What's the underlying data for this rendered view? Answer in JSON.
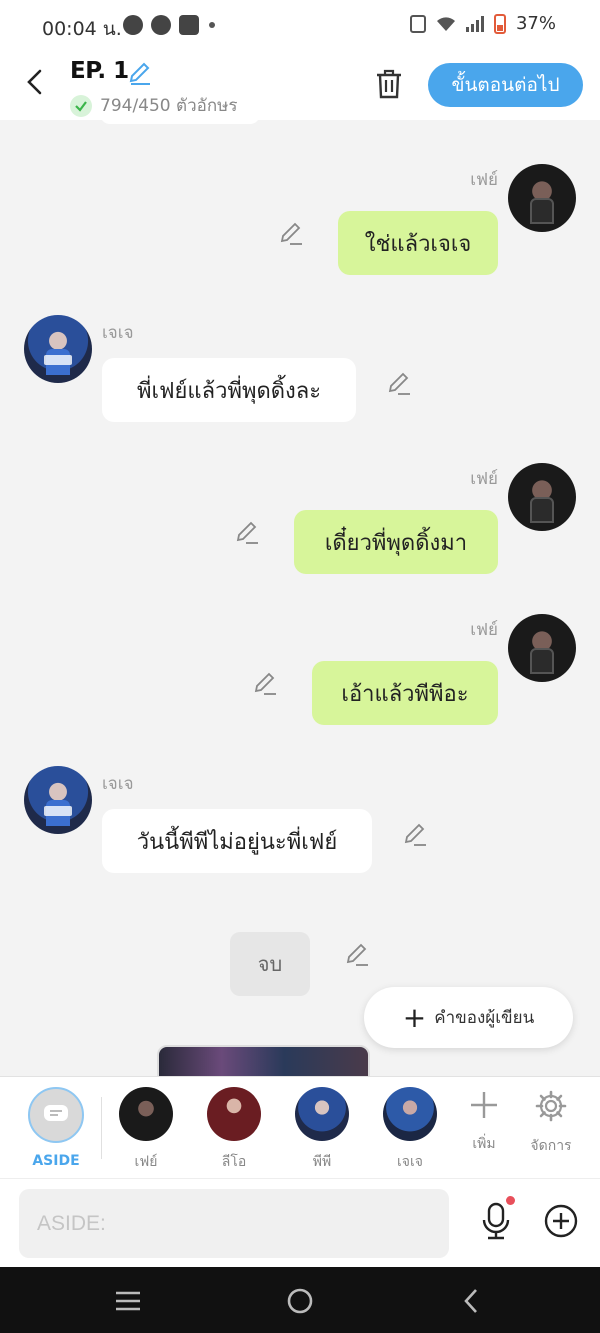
{
  "status": {
    "time": "00:04 น.",
    "battery": "37%"
  },
  "header": {
    "title": "EP. 1",
    "char_count": "794/450 ตัวอักษร",
    "next_label": "ขั้นตอนต่อไป"
  },
  "messages": [
    {
      "side": "right",
      "name": "เฟย์",
      "text": "ใช่แล้วเจเจ"
    },
    {
      "side": "left",
      "name": "เจเจ",
      "text": "พี่เฟย์แล้วพี่พุดดิ้งละ"
    },
    {
      "side": "right",
      "name": "เฟย์",
      "text": "เดี๋ยวพี่พุดดิ้งมา"
    },
    {
      "side": "right",
      "name": "เฟย์",
      "text": "เอ้าแล้วพีพีอะ"
    },
    {
      "side": "left",
      "name": "เจเจ",
      "text": "วันนี้พีพีไม่อยู่นะพี่เฟย์"
    }
  ],
  "end_chip": "จบ",
  "writer_button": "คำของผู้เขียน",
  "characters": [
    {
      "label": "ASIDE"
    },
    {
      "label": "เฟย์"
    },
    {
      "label": "ลีโอ"
    },
    {
      "label": "พีพี"
    },
    {
      "label": "เจเจ"
    }
  ],
  "tools": {
    "add": "เพิ่ม",
    "manage": "จัดการ"
  },
  "input": {
    "placeholder": "ASIDE:"
  },
  "colors": {
    "accent": "#4aa6ec",
    "bubble_right": "#d7f59a",
    "bubble_left": "#ffffff"
  }
}
